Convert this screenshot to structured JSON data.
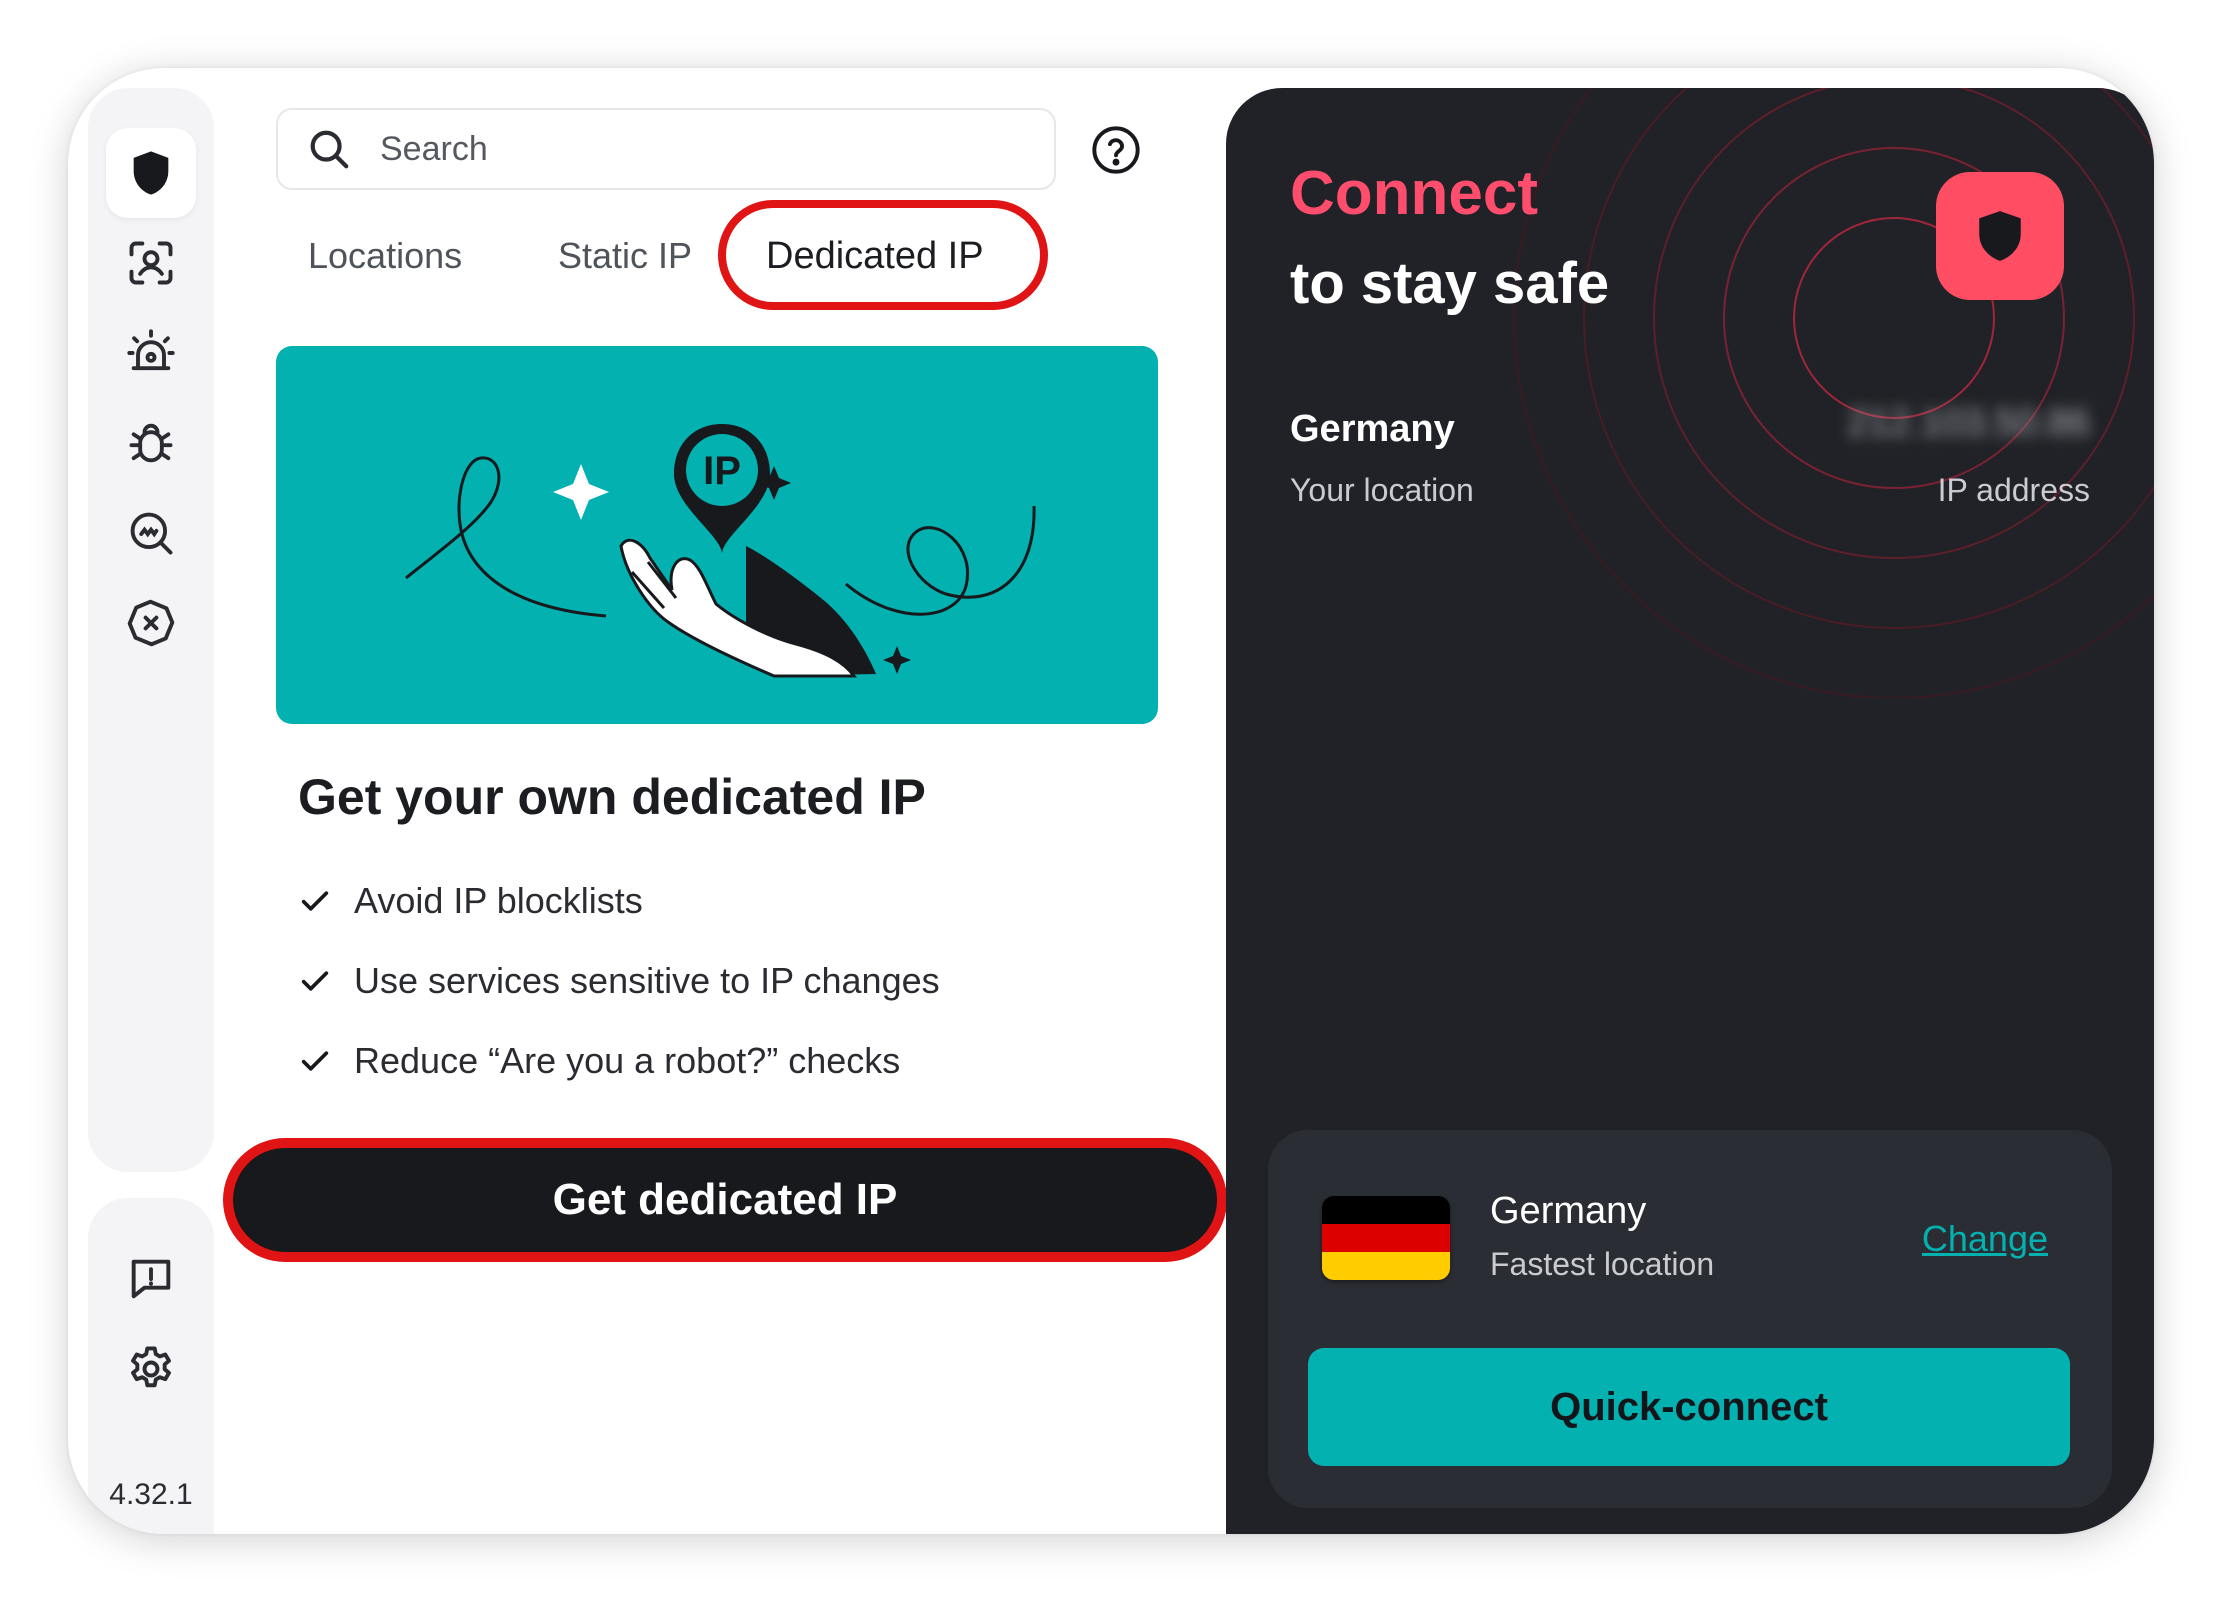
{
  "app": {
    "version": "4.32.1"
  },
  "sidebar": {
    "items": [
      {
        "icon": "shield-icon",
        "active": true
      },
      {
        "icon": "person-scan-icon",
        "active": false
      },
      {
        "icon": "alarm-icon",
        "active": false
      },
      {
        "icon": "bug-icon",
        "active": false
      },
      {
        "icon": "search-monitor-icon",
        "active": false
      },
      {
        "icon": "block-icon",
        "active": false
      }
    ],
    "bottom_items": [
      {
        "icon": "feedback-icon"
      },
      {
        "icon": "gear-icon"
      }
    ]
  },
  "search": {
    "placeholder": "Search"
  },
  "tabs": [
    {
      "label": "Locations",
      "active": false
    },
    {
      "label": "Static IP",
      "active": false
    },
    {
      "label": "Dedicated IP",
      "active": true
    }
  ],
  "promo": {
    "banner_badge": "IP",
    "title": "Get your own dedicated IP",
    "benefits": [
      "Avoid IP blocklists",
      "Use services sensitive to IP changes",
      "Reduce “Are you a robot?” checks"
    ],
    "cta_label": "Get dedicated IP"
  },
  "status": {
    "headline_accent": "Connect",
    "headline_rest": "to stay safe",
    "location_value": "Germany",
    "location_label": "Your location",
    "ip_value": "212.103.50.86",
    "ip_label": "IP address"
  },
  "quick_connect": {
    "country": "Germany",
    "subtitle": "Fastest location",
    "change_label": "Change",
    "button_label": "Quick-connect"
  },
  "colors": {
    "accent_teal": "#03b1b0",
    "accent_red": "#ff4d63",
    "highlight_red": "#e01414",
    "dark_panel": "#202227"
  }
}
